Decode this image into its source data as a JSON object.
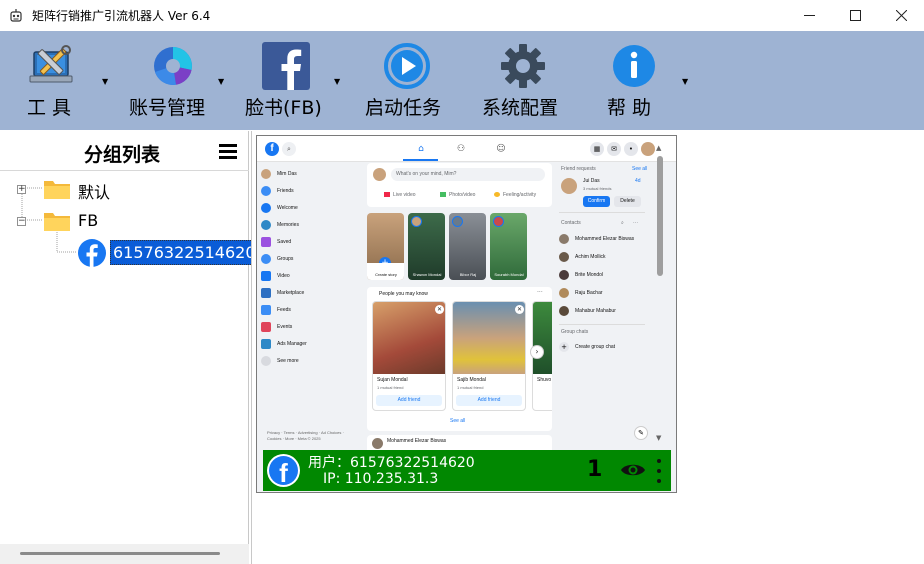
{
  "window": {
    "title": "矩阵行销推广引流机器人 Ver 6.4",
    "minimize": "—",
    "maximize": "☐",
    "close": "✕"
  },
  "toolbar": {
    "items": [
      {
        "label": "工  具",
        "icon": "tools-icon",
        "has_menu": true
      },
      {
        "label": "账号管理",
        "icon": "pie-chart-icon",
        "has_menu": true
      },
      {
        "label": "脸书(FB)",
        "icon": "facebook-icon",
        "has_menu": true
      },
      {
        "label": "启动任务",
        "icon": "play-icon",
        "has_menu": false
      },
      {
        "label": "系统配置",
        "icon": "gear-icon",
        "has_menu": false
      },
      {
        "label": "帮  助",
        "icon": "info-icon",
        "has_menu": true
      }
    ],
    "colors": {
      "background": "#9eb3d3"
    }
  },
  "left_panel": {
    "title": "分组列表",
    "tree": [
      {
        "label": "默认",
        "expander": "+"
      },
      {
        "label": "FB",
        "expander": "−",
        "children": [
          {
            "label": "61576322514620",
            "selected": true
          }
        ]
      }
    ]
  },
  "fb_preview": {
    "sidebar": [
      "Mim Das",
      "Friends",
      "Welcome",
      "Memories",
      "Saved",
      "Groups",
      "Video",
      "Marketplace",
      "Feeds",
      "Events",
      "Ads Manager",
      "See more"
    ],
    "footer": "Privacy · Terms · Advertising · Ad Choices · Cookies · More · Meta © 2025",
    "composer_placeholder": "What's on your mind, Mim?",
    "composer_actions": [
      "Live video",
      "Photo/video",
      "Feeling/activity"
    ],
    "stories": [
      "Create story",
      "Shawon Mondal",
      "Bibor Raj",
      "Sourabh Mondal"
    ],
    "pymk_title": "People you may know",
    "people": [
      {
        "name": "Sujan Mondal",
        "mutual": "1 mutual friend",
        "action": "Add friend"
      },
      {
        "name": "Sajib Mondal",
        "mutual": "1 mutual friend",
        "action": "Add friend"
      },
      {
        "name": "Shuvo",
        "mutual": "",
        "action": ""
      }
    ],
    "see_all": "See all",
    "next_post_author": "Mohammed Elezar Biswas",
    "right": {
      "friend_requests": "Friend requests",
      "see_all": "See all",
      "requester": "Jui Das",
      "requester_mutual": "3 mutual friends",
      "requester_time": "4d",
      "confirm": "Confirm",
      "delete": "Delete",
      "contacts": "Contacts",
      "contact_list": [
        "Mohammed Elezar Biswas",
        "Achim Mollick",
        "Brite Mondol",
        "Raju Bachar",
        "Mahabur Mahabur"
      ],
      "group_chats": "Group chats",
      "create_group": "Create group chat"
    }
  },
  "status_bar": {
    "user": "用户：61576322514620",
    "ip": "IP: 110.235.31.3",
    "count": "1",
    "colors": {
      "background": "#018801"
    }
  }
}
